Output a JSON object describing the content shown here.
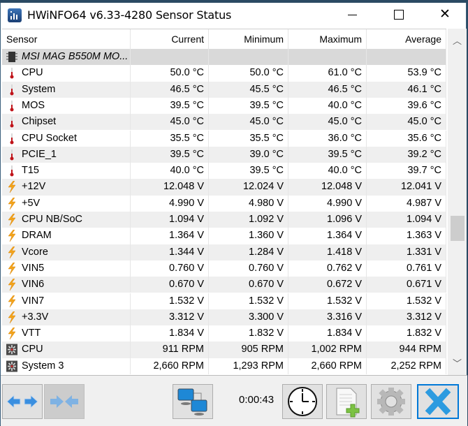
{
  "window": {
    "title": "HWiNFO64 v6.33-4280 Sensor Status",
    "controls": {
      "minimize": "minimize",
      "maximize": "maximize",
      "close": "close"
    }
  },
  "table": {
    "columns": [
      "Sensor",
      "Current",
      "Minimum",
      "Maximum",
      "Average"
    ],
    "rows": [
      {
        "type": "group",
        "icon": "chip-icon",
        "name": "MSI MAG B550M MO...",
        "current": "",
        "minimum": "",
        "maximum": "",
        "average": ""
      },
      {
        "type": "temp",
        "icon": "thermometer-icon",
        "name": "CPU",
        "current": "50.0 °C",
        "minimum": "50.0 °C",
        "maximum": "61.0 °C",
        "average": "53.9 °C"
      },
      {
        "type": "temp",
        "icon": "thermometer-icon",
        "name": "System",
        "current": "46.5 °C",
        "minimum": "45.5 °C",
        "maximum": "46.5 °C",
        "average": "46.1 °C"
      },
      {
        "type": "temp",
        "icon": "thermometer-icon",
        "name": "MOS",
        "current": "39.5 °C",
        "minimum": "39.5 °C",
        "maximum": "40.0 °C",
        "average": "39.6 °C"
      },
      {
        "type": "temp",
        "icon": "thermometer-icon",
        "name": "Chipset",
        "current": "45.0 °C",
        "minimum": "45.0 °C",
        "maximum": "45.0 °C",
        "average": "45.0 °C"
      },
      {
        "type": "temp",
        "icon": "thermometer-icon",
        "name": "CPU Socket",
        "current": "35.5 °C",
        "minimum": "35.5 °C",
        "maximum": "36.0 °C",
        "average": "35.6 °C"
      },
      {
        "type": "temp",
        "icon": "thermometer-icon",
        "name": "PCIE_1",
        "current": "39.5 °C",
        "minimum": "39.0 °C",
        "maximum": "39.5 °C",
        "average": "39.2 °C"
      },
      {
        "type": "temp",
        "icon": "thermometer-icon",
        "name": "T15",
        "current": "40.0 °C",
        "minimum": "39.5 °C",
        "maximum": "40.0 °C",
        "average": "39.7 °C"
      },
      {
        "type": "volt",
        "icon": "lightning-icon",
        "name": "+12V",
        "current": "12.048 V",
        "minimum": "12.024 V",
        "maximum": "12.048 V",
        "average": "12.041 V"
      },
      {
        "type": "volt",
        "icon": "lightning-icon",
        "name": "+5V",
        "current": "4.990 V",
        "minimum": "4.980 V",
        "maximum": "4.990 V",
        "average": "4.987 V"
      },
      {
        "type": "volt",
        "icon": "lightning-icon",
        "name": "CPU NB/SoC",
        "current": "1.094 V",
        "minimum": "1.092 V",
        "maximum": "1.096 V",
        "average": "1.094 V"
      },
      {
        "type": "volt",
        "icon": "lightning-icon",
        "name": "DRAM",
        "current": "1.364 V",
        "minimum": "1.360 V",
        "maximum": "1.364 V",
        "average": "1.363 V"
      },
      {
        "type": "volt",
        "icon": "lightning-icon",
        "name": "Vcore",
        "current": "1.344 V",
        "minimum": "1.284 V",
        "maximum": "1.418 V",
        "average": "1.331 V"
      },
      {
        "type": "volt",
        "icon": "lightning-icon",
        "name": "VIN5",
        "current": "0.760 V",
        "minimum": "0.760 V",
        "maximum": "0.762 V",
        "average": "0.761 V"
      },
      {
        "type": "volt",
        "icon": "lightning-icon",
        "name": "VIN6",
        "current": "0.670 V",
        "minimum": "0.670 V",
        "maximum": "0.672 V",
        "average": "0.671 V"
      },
      {
        "type": "volt",
        "icon": "lightning-icon",
        "name": "VIN7",
        "current": "1.532 V",
        "minimum": "1.532 V",
        "maximum": "1.532 V",
        "average": "1.532 V"
      },
      {
        "type": "volt",
        "icon": "lightning-icon",
        "name": "+3.3V",
        "current": "3.312 V",
        "minimum": "3.300 V",
        "maximum": "3.316 V",
        "average": "3.312 V"
      },
      {
        "type": "volt",
        "icon": "lightning-icon",
        "name": "VTT",
        "current": "1.834 V",
        "minimum": "1.832 V",
        "maximum": "1.834 V",
        "average": "1.832 V"
      },
      {
        "type": "fan",
        "icon": "fan-icon",
        "name": "CPU",
        "current": "911 RPM",
        "minimum": "905 RPM",
        "maximum": "1,002 RPM",
        "average": "944 RPM"
      },
      {
        "type": "fan",
        "icon": "fan-icon",
        "name": "System 3",
        "current": "2,660 RPM",
        "minimum": "1,293 RPM",
        "maximum": "2,660 RPM",
        "average": "2,252 RPM"
      }
    ]
  },
  "scrollbar": {
    "position_fraction": 0.55
  },
  "toolbar": {
    "buttons": [
      {
        "name": "expand-columns",
        "icon": "arrows-expand-icon",
        "enabled": true
      },
      {
        "name": "collapse-columns",
        "icon": "arrows-collapse-icon",
        "enabled": false
      },
      {
        "name": "network",
        "icon": "network-computers-icon",
        "enabled": true
      },
      {
        "name": "reset-clock",
        "icon": "clock-icon",
        "enabled": true
      },
      {
        "name": "logging",
        "icon": "add-log-icon",
        "enabled": true
      },
      {
        "name": "settings",
        "icon": "gear-icon",
        "enabled": true
      },
      {
        "name": "close",
        "icon": "blue-x-icon",
        "enabled": true
      }
    ],
    "timer": "0:00:43"
  },
  "colors": {
    "accent": "#0078d7",
    "group_row": "#d9d9d9",
    "alt_row": "#efefef"
  }
}
